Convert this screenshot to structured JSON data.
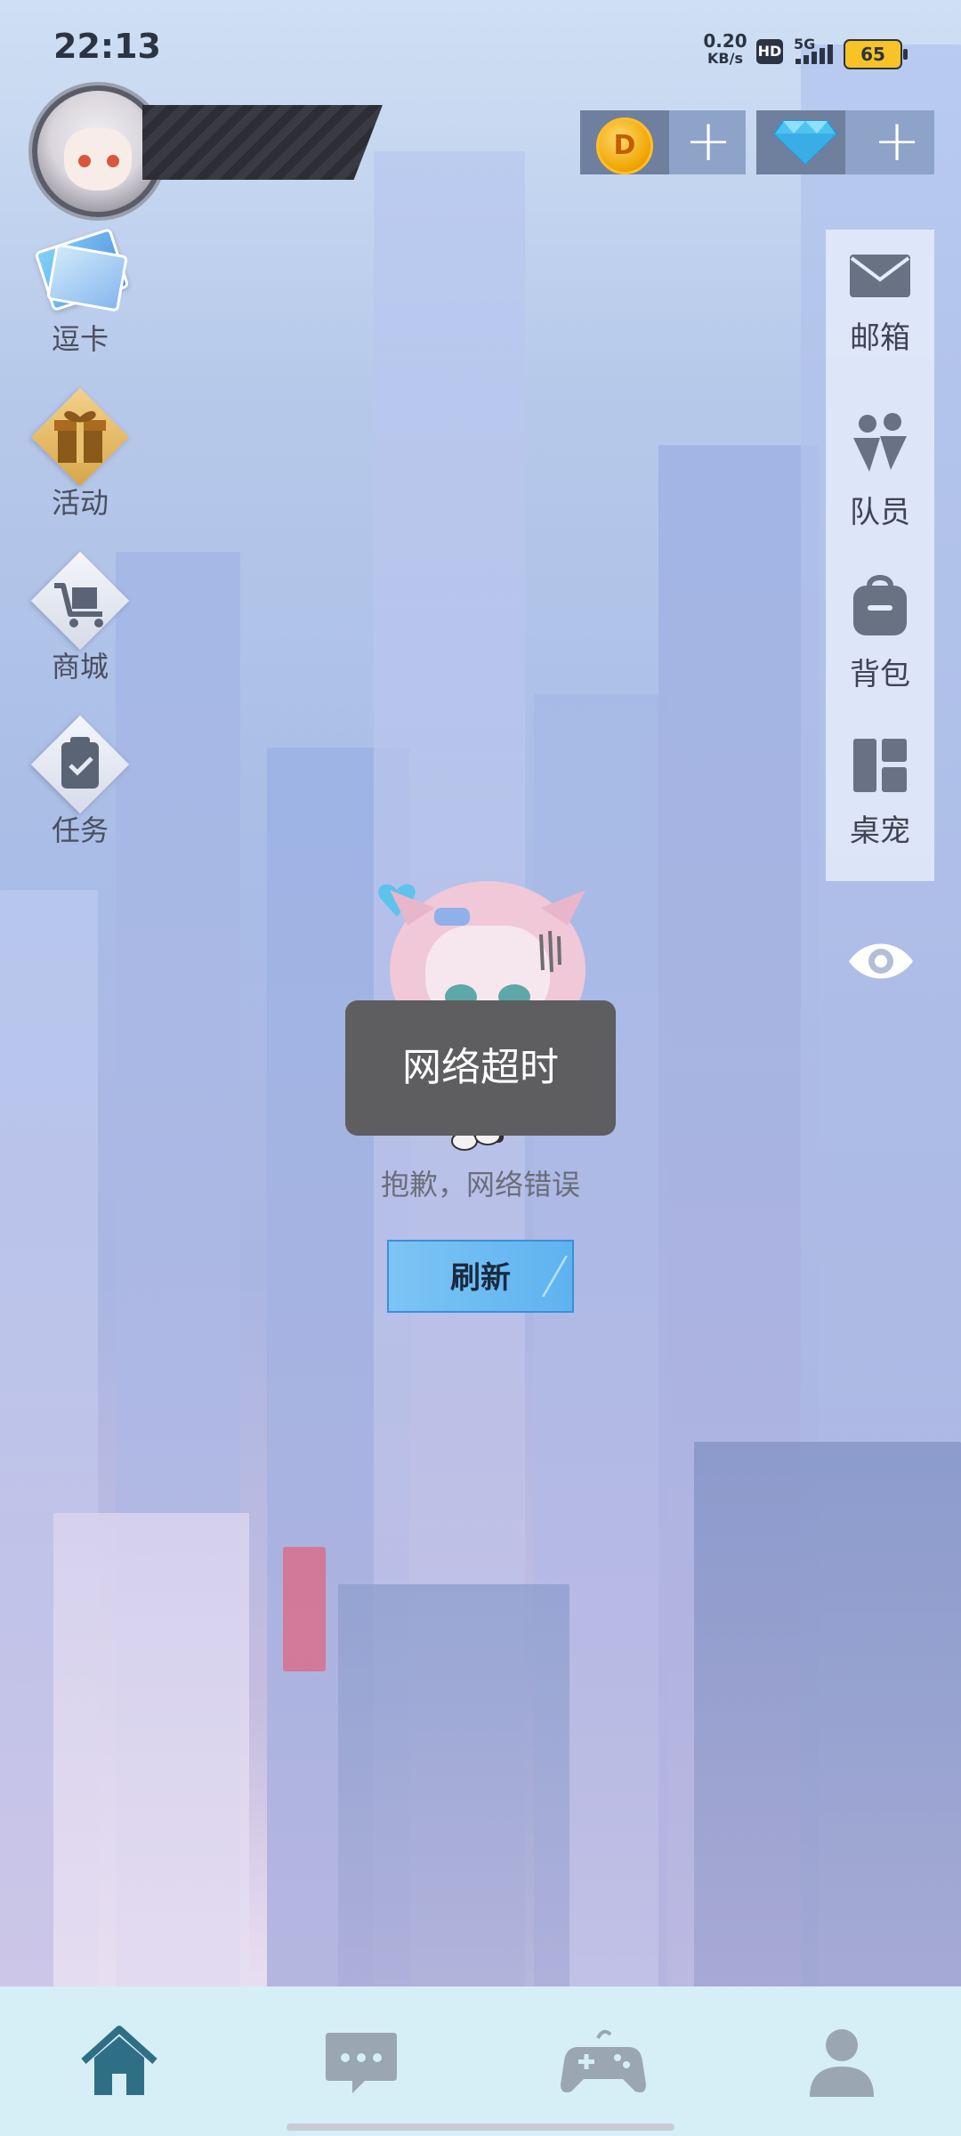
{
  "status_bar": {
    "time": "22:13",
    "net_speed_value": "0.20",
    "net_speed_unit": "KB/s",
    "hd_badge": "HD",
    "network_type": "5G",
    "battery": "65"
  },
  "currency": {
    "coin_symbol": "D",
    "add_label": "+"
  },
  "left_menu": [
    {
      "label": "逗卡",
      "icon": "card-icon"
    },
    {
      "label": "活动",
      "icon": "gift-icon"
    },
    {
      "label": "商城",
      "icon": "cart-icon"
    },
    {
      "label": "任务",
      "icon": "clipboard-check-icon"
    }
  ],
  "right_menu": [
    {
      "label": "邮箱",
      "icon": "mail-icon"
    },
    {
      "label": "队员",
      "icon": "members-icon"
    },
    {
      "label": "背包",
      "icon": "backpack-icon"
    },
    {
      "label": "桌宠",
      "icon": "desktop-pet-icon"
    }
  ],
  "toast": "网络超时",
  "error_message": "抱歉，网络错误",
  "refresh_button": "刷新",
  "bottom_nav": [
    {
      "icon": "home-icon",
      "active": true
    },
    {
      "icon": "chat-icon",
      "active": false
    },
    {
      "icon": "gamepad-icon",
      "active": false
    },
    {
      "icon": "profile-icon",
      "active": false
    }
  ],
  "colors": {
    "accent": "#2f6f86",
    "toast_bg": "#5e5e60",
    "refresh_bg": "#6bbcf2"
  }
}
